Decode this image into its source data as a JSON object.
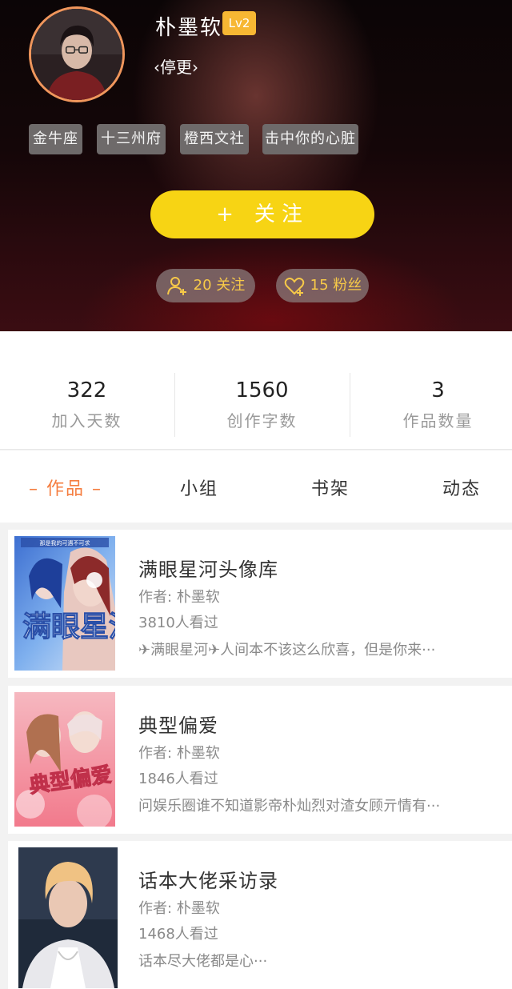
{
  "profile": {
    "name": "朴墨软",
    "level": "Lv2",
    "status": "‹停更›",
    "tags": [
      "金牛座",
      "十三州府",
      "橙西文社",
      "击中你的心脏"
    ],
    "follow_label": "关注",
    "follow_icon": "plus-icon",
    "following_count": "20 关注",
    "fans_count": "15 粉丝"
  },
  "stats": [
    {
      "value": "322",
      "label": "加入天数"
    },
    {
      "value": "1560",
      "label": "创作字数"
    },
    {
      "value": "3",
      "label": "作品数量"
    }
  ],
  "tabs": [
    {
      "label": "– 作品 –",
      "active": true
    },
    {
      "label": "小组",
      "active": false
    },
    {
      "label": "书架",
      "active": false
    },
    {
      "label": "动态",
      "active": false
    }
  ],
  "works": [
    {
      "title": "满眼星河头像库",
      "author": "作者: 朴墨软",
      "views": "3810人看过",
      "desc": "✈满眼星河✈人间本不该这么欣喜，但是你来···",
      "cover_text": "满眼星河",
      "cover_caption": "那是我的可遇不可求"
    },
    {
      "title": "典型偏爱",
      "author": "作者: 朴墨软",
      "views": "1846人看过",
      "desc": "问娱乐圈谁不知道影帝朴灿烈对渣女顾亓情有···",
      "cover_text": "典型偏爱"
    },
    {
      "title": "话本大佬采访录",
      "author": "作者: 朴墨软",
      "views": "1468人看过",
      "desc": "话本尽大佬都是心···"
    }
  ],
  "colors": {
    "accent": "#f57d3f",
    "follow_button": "#f7d414",
    "level_badge": "#f7b733",
    "pill_text": "#f7c948"
  }
}
